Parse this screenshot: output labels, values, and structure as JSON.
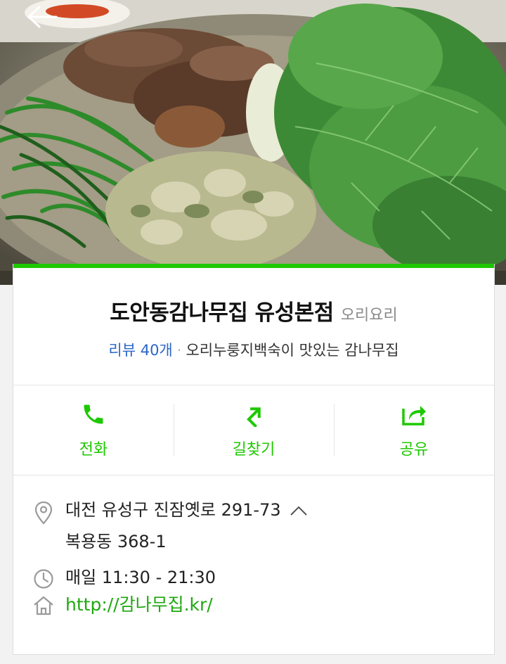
{
  "header": {
    "back_icon": "back-arrow-icon"
  },
  "photo": {
    "alt": "food photo"
  },
  "place": {
    "name": "도안동감나무집 유성본점",
    "category": "오리요리",
    "review_count": "리뷰 40개",
    "separator": "·",
    "description": "오리누룽지백숙이 맛있는 감나무집"
  },
  "actions": [
    {
      "label": "전화",
      "icon": "phone-icon"
    },
    {
      "label": "길찾기",
      "icon": "directions-icon"
    },
    {
      "label": "공유",
      "icon": "share-icon"
    }
  ],
  "info": {
    "address_line1": "대전 유성구 진잠옛로 291-73",
    "address_line2": "복용동 368-1",
    "hours": "매일 11:30 - 21:30",
    "website": "http://감나무집.kr/"
  },
  "colors": {
    "accent": "#1ec800",
    "link": "#2b66c8"
  }
}
